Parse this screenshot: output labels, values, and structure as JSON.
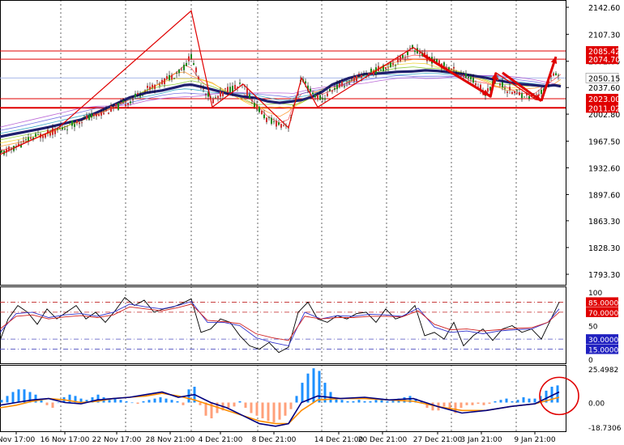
{
  "chart_data": [
    {
      "type": "candlestick",
      "y_ticks": [
        "2142.60",
        "2107.30",
        "2072.00",
        "2037.60",
        "2002.80",
        "1967.50",
        "1932.60",
        "1897.60",
        "1863.30",
        "1828.30",
        "1793.30"
      ],
      "ylim": [
        1770,
        2155
      ],
      "price_line": {
        "value": 2050.15,
        "label": "2050.15"
      },
      "levels": [
        {
          "value": 2085.42,
          "label": "2085.42",
          "thick": false
        },
        {
          "value": 2074.7,
          "label": "2074.70",
          "thick": false
        },
        {
          "value": 2023.0,
          "label": "2023.00",
          "thick": false
        },
        {
          "value": 2011.02,
          "label": "2011.02",
          "thick": true
        }
      ],
      "zigzag": [
        [
          0,
          1950
        ],
        [
          72,
          1985
        ],
        [
          236,
          2138
        ],
        [
          262,
          2012
        ],
        [
          300,
          2042
        ],
        [
          356,
          1985
        ],
        [
          372,
          2050
        ],
        [
          392,
          2012
        ],
        [
          510,
          2090
        ],
        [
          605,
          2025
        ],
        [
          612,
          2057
        ],
        [
          660,
          2023
        ]
      ],
      "arrows": [
        [
          [
            522,
            2080
          ],
          [
            604,
            2027
          ]
        ],
        [
          [
            605,
            2025
          ],
          [
            612,
            2057
          ]
        ],
        [
          [
            620,
            2057
          ],
          [
            668,
            2020
          ]
        ],
        [
          [
            668,
            2020
          ],
          [
            686,
            2078
          ]
        ]
      ],
      "close_path": [
        [
          0,
          1950
        ],
        [
          20,
          1960
        ],
        [
          40,
          1972
        ],
        [
          60,
          1978
        ],
        [
          80,
          1985
        ],
        [
          100,
          1995
        ],
        [
          120,
          2002
        ],
        [
          140,
          2010
        ],
        [
          160,
          2020
        ],
        [
          180,
          2035
        ],
        [
          200,
          2045
        ],
        [
          215,
          2055
        ],
        [
          228,
          2065
        ],
        [
          236,
          2080
        ],
        [
          246,
          2045
        ],
        [
          262,
          2020
        ],
        [
          280,
          2035
        ],
        [
          300,
          2040
        ],
        [
          315,
          2015
        ],
        [
          330,
          1995
        ],
        [
          345,
          1990
        ],
        [
          356,
          1988
        ],
        [
          362,
          2010
        ],
        [
          372,
          2048
        ],
        [
          385,
          2030
        ],
        [
          398,
          2022
        ],
        [
          410,
          2035
        ],
        [
          430,
          2045
        ],
        [
          450,
          2055
        ],
        [
          470,
          2062
        ],
        [
          490,
          2072
        ],
        [
          510,
          2090
        ],
        [
          525,
          2078
        ],
        [
          540,
          2070
        ],
        [
          560,
          2060
        ],
        [
          580,
          2050
        ],
        [
          600,
          2030
        ],
        [
          612,
          2050
        ],
        [
          625,
          2035
        ],
        [
          640,
          2030
        ],
        [
          660,
          2025
        ],
        [
          672,
          2035
        ],
        [
          684,
          2060
        ],
        [
          692,
          2050
        ]
      ]
    },
    {
      "type": "line",
      "y_ticks": [
        "100",
        "50",
        "0"
      ],
      "ylim": [
        0,
        100
      ],
      "levels": [
        {
          "value": 85,
          "label": "85.0000"
        },
        {
          "value": 70,
          "label": "70.0000"
        },
        {
          "value": 30,
          "label": "30.0000"
        },
        {
          "value": 15,
          "label": "15.0000"
        }
      ],
      "series": [
        {
          "color": "#000000",
          "x": [
            0,
            10,
            22,
            34,
            46,
            58,
            70,
            82,
            94,
            106,
            118,
            130,
            142,
            154,
            166,
            178,
            190,
            202,
            214,
            226,
            236,
            248,
            260,
            272,
            284,
            296,
            308,
            320,
            332,
            344,
            356,
            368,
            380,
            392,
            404,
            416,
            428,
            440,
            452,
            464,
            476,
            488,
            500,
            512,
            524,
            536,
            548,
            560,
            572,
            584,
            596,
            608,
            620,
            632,
            644,
            656,
            668,
            680,
            690
          ],
          "y": [
            28,
            60,
            80,
            70,
            52,
            75,
            60,
            70,
            80,
            60,
            70,
            55,
            72,
            92,
            80,
            88,
            70,
            75,
            78,
            84,
            90,
            40,
            45,
            60,
            55,
            35,
            20,
            15,
            25,
            10,
            18,
            70,
            85,
            60,
            55,
            65,
            60,
            68,
            70,
            55,
            75,
            60,
            65,
            80,
            35,
            40,
            30,
            55,
            20,
            35,
            45,
            28,
            45,
            50,
            40,
            45,
            30,
            60,
            85
          ]
        },
        {
          "color": "#3333cc",
          "x": [
            0,
            20,
            40,
            60,
            80,
            100,
            120,
            140,
            160,
            180,
            200,
            220,
            236,
            256,
            276,
            296,
            316,
            336,
            356,
            376,
            396,
            416,
            436,
            456,
            476,
            496,
            516,
            536,
            556,
            576,
            596,
            616,
            636,
            656,
            676,
            690
          ],
          "y": [
            40,
            68,
            70,
            62,
            66,
            68,
            64,
            70,
            82,
            78,
            75,
            80,
            86,
            55,
            55,
            50,
            32,
            25,
            20,
            70,
            60,
            65,
            64,
            67,
            66,
            64,
            76,
            48,
            40,
            42,
            38,
            42,
            44,
            45,
            55,
            75
          ]
        },
        {
          "color": "#d01f1f",
          "x": [
            0,
            20,
            40,
            60,
            80,
            100,
            120,
            140,
            160,
            180,
            200,
            220,
            236,
            256,
            276,
            296,
            316,
            336,
            356,
            376,
            396,
            416,
            436,
            456,
            476,
            496,
            516,
            536,
            556,
            576,
            596,
            616,
            636,
            656,
            676,
            690
          ],
          "y": [
            45,
            64,
            66,
            60,
            63,
            65,
            62,
            66,
            78,
            75,
            72,
            77,
            82,
            58,
            56,
            53,
            38,
            32,
            28,
            64,
            60,
            62,
            62,
            64,
            64,
            63,
            72,
            52,
            44,
            45,
            42,
            44,
            46,
            47,
            55,
            70
          ]
        }
      ]
    },
    {
      "type": "bar",
      "y_ticks": [
        "25.4982",
        "0.00",
        "-18.7306"
      ],
      "ylim": [
        -18.7306,
        25.4982
      ],
      "histogram_x": [
        2,
        9,
        16,
        23,
        30,
        37,
        44,
        51,
        58,
        65,
        72,
        79,
        86,
        93,
        100,
        107,
        114,
        121,
        128,
        135,
        142,
        149,
        156,
        163,
        170,
        177,
        184,
        191,
        198,
        205,
        212,
        219,
        226,
        233,
        240,
        247,
        254,
        261,
        268,
        275,
        282,
        289,
        296,
        303,
        310,
        317,
        324,
        331,
        338,
        345,
        352,
        359,
        366,
        373,
        380,
        387,
        394,
        401,
        408,
        415,
        422,
        429,
        436,
        443,
        450,
        457,
        464,
        471,
        478,
        485,
        492,
        499,
        506,
        513,
        520,
        527,
        534,
        541,
        548,
        555,
        562,
        569,
        576,
        583,
        590,
        597,
        604,
        611,
        618,
        625,
        632,
        639,
        646,
        653,
        660,
        667,
        674,
        681,
        688
      ],
      "histogram": [
        2,
        5,
        8,
        10,
        10,
        8,
        6,
        3,
        -2,
        -4,
        0,
        4,
        6,
        5,
        3,
        2,
        4,
        6,
        4,
        2,
        3,
        2,
        1,
        0,
        -1,
        1,
        2,
        3,
        4,
        3,
        2,
        1,
        -2,
        10,
        12,
        -2,
        -10,
        -12,
        -8,
        -6,
        -4,
        -3,
        1,
        -4,
        -8,
        -10,
        -12,
        -14,
        -15,
        -13,
        -10,
        -5,
        5,
        15,
        22,
        26,
        24,
        15,
        8,
        3,
        2,
        1,
        1,
        2,
        1,
        1,
        2,
        3,
        1,
        2,
        3,
        4,
        5,
        3,
        1,
        -4,
        -6,
        -6,
        -3,
        -5,
        -8,
        -4,
        -2,
        -2,
        -1,
        -2,
        -1,
        1,
        2,
        3,
        1,
        2,
        4,
        3,
        3,
        5,
        9,
        12,
        13
      ],
      "signal_x": [
        0,
        20,
        40,
        60,
        80,
        100,
        120,
        140,
        160,
        180,
        200,
        220,
        240,
        260,
        280,
        300,
        320,
        340,
        356,
        372,
        392,
        420,
        450,
        480,
        510,
        540,
        570,
        600,
        630,
        660,
        690
      ],
      "signal": [
        -4,
        -2,
        1,
        3,
        2,
        0,
        1,
        3,
        4,
        5,
        7,
        5,
        2,
        -2,
        -6,
        -10,
        -14,
        -16,
        -16,
        -6,
        2,
        3,
        3,
        2,
        1,
        -3,
        -6,
        -6,
        -3,
        -1,
        4
      ],
      "macd_x": [
        0,
        20,
        40,
        60,
        80,
        100,
        120,
        140,
        160,
        180,
        200,
        220,
        240,
        260,
        280,
        300,
        320,
        340,
        356,
        372,
        392,
        420,
        450,
        480,
        510,
        540,
        570,
        600,
        630,
        660,
        690
      ],
      "macd": [
        -2,
        0,
        2,
        3,
        0,
        -1,
        2,
        3,
        4,
        6,
        8,
        4,
        6,
        0,
        -4,
        -10,
        -16,
        -18,
        -16,
        0,
        5,
        3,
        4,
        2,
        3,
        -3,
        -8,
        -6,
        -3,
        -1,
        8
      ]
    }
  ],
  "x_labels": [
    "Nov 17:00",
    "16 Nov 17:00",
    "22 Nov 17:00",
    "28 Nov 21:00",
    "4 Dec 21:00",
    "8 Dec 21:00",
    "14 Dec 21:00",
    "20 Dec 21:00",
    "27 Dec 21:00",
    "3 Jan 21:00",
    "9 Jan 21:00"
  ],
  "colors": {
    "background": "#ffffff",
    "grid": "#000000",
    "level_line": "#e00000",
    "price_line": "#a8b8e8",
    "candle_up": "#1d8a1d",
    "candle_down": "#d03030",
    "ma_main": "#1f1f6e",
    "hist_pos": "#1e90ff",
    "hist_neg": "#ffa07a",
    "signal_line": "#ff8c00",
    "macd_line": "#000080",
    "annotation": "#e00000"
  }
}
